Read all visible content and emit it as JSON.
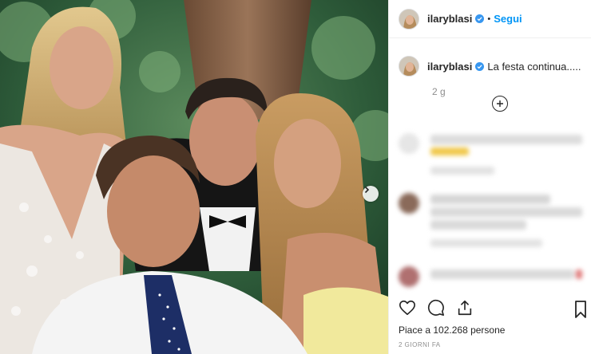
{
  "post": {
    "username": "ilaryblasi",
    "follow_label": "Segui",
    "separator": "•",
    "caption_username": "ilaryblasi",
    "caption_text": "La festa continua.....",
    "age": "2 g",
    "likes": "Piace a 102.268 persone",
    "date": "2 GIORNI FA"
  },
  "colors": {
    "verified": "#3897f0",
    "follow": "#0095f6",
    "muted": "#8e8e8e"
  },
  "icons": {
    "verified": "verified-badge-icon",
    "load_more": "plus-circle-icon",
    "next": "chevron-right-icon",
    "like": "heart-icon",
    "comment": "comment-icon",
    "share": "share-icon",
    "save": "bookmark-icon"
  }
}
